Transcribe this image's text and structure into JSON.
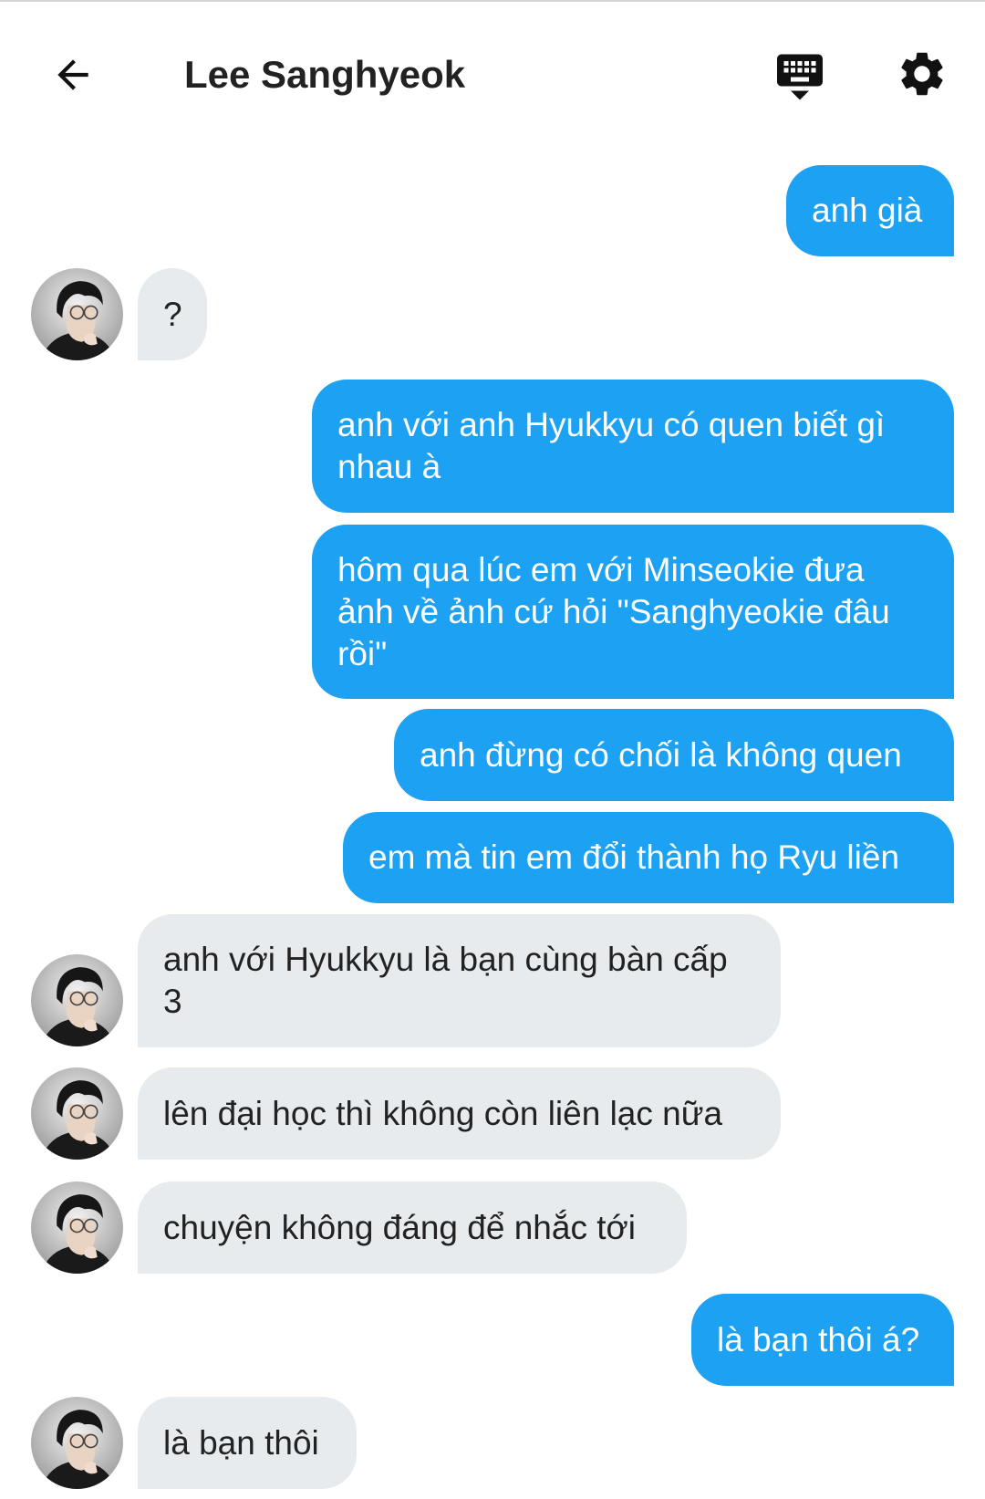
{
  "header": {
    "back_icon": "arrow-left-icon",
    "title": "Lee Sanghyeok",
    "keyboard_icon": "keyboard-hide-icon",
    "settings_icon": "gear-icon"
  },
  "colors": {
    "sent_bubble": "#1da1f2",
    "received_bubble": "#e8ebed"
  },
  "messages": [
    {
      "from": "me",
      "text": "anh già"
    },
    {
      "from": "Lee Sanghyeok",
      "text": "?"
    },
    {
      "from": "me",
      "text": "anh với anh Hyukkyu có quen biết gì nhau à"
    },
    {
      "from": "me",
      "text": "hôm qua lúc em với Minseokie đưa ảnh về ảnh cứ hỏi \"Sanghyeokie đâu rồi\""
    },
    {
      "from": "me",
      "text": "anh đừng có chối là không quen"
    },
    {
      "from": "me",
      "text": "em mà tin em đổi thành họ Ryu liền"
    },
    {
      "from": "Lee Sanghyeok",
      "text": "anh với Hyukkyu là bạn cùng bàn cấp 3"
    },
    {
      "from": "Lee Sanghyeok",
      "text": "lên đại học thì không còn liên lạc nữa"
    },
    {
      "from": "Lee Sanghyeok",
      "text": "chuyện không đáng để nhắc tới"
    },
    {
      "from": "me",
      "text": "là bạn thôi á?"
    },
    {
      "from": "Lee Sanghyeok",
      "text": "là bạn thôi"
    }
  ]
}
